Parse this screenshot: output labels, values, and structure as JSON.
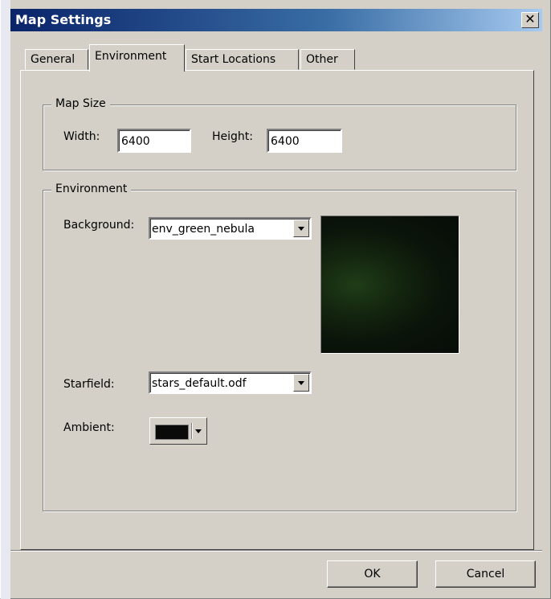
{
  "window": {
    "title": "Map Settings",
    "close_label": "✕"
  },
  "tabs": [
    {
      "label": "General"
    },
    {
      "label": "Environment"
    },
    {
      "label": "Start Locations"
    },
    {
      "label": "Other"
    }
  ],
  "active_tab": "Environment",
  "map_size": {
    "legend": "Map Size",
    "width_label": "Width:",
    "width_value": "6400",
    "height_label": "Height:",
    "height_value": "6400"
  },
  "environment": {
    "legend": "Environment",
    "background_label": "Background:",
    "background_value": "env_green_nebula",
    "starfield_label": "Starfield:",
    "starfield_value": "stars_default.odf",
    "ambient_label": "Ambient:",
    "ambient_color": "#0a0a0a"
  },
  "buttons": {
    "ok": "OK",
    "cancel": "Cancel"
  }
}
